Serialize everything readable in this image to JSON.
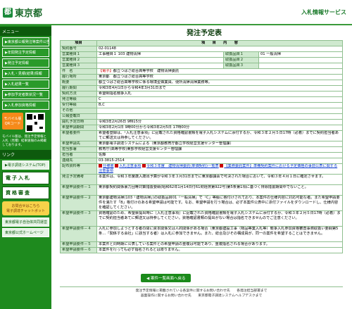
{
  "header": {
    "logo_mark": "都",
    "logo_text": "東京都",
    "service_title": "入札情報サービス"
  },
  "sidebar": {
    "menu_title": "メニュー",
    "items": [
      "▶東京都公報発注等案件公告",
      "▶年間発注予定情報",
      "▶発注予定情報",
      "▶入札・見積(結果)情報",
      "▶入札結果一覧",
      "▶参加予定者数状況一覧",
      "▶入札参加資格情報"
    ],
    "mobile_label": "モバイル版",
    "mobile_sub": "QRコード",
    "note": "モバイル版は、発注予定情報と入札（見積）結果速報のみ掲載しております。",
    "link_title": "リンク",
    "link_items": [
      "▶電子調達システム(TOP)"
    ],
    "big_buttons": [
      "電子入札",
      "資格審査"
    ],
    "help_title": "お問合せはこちら",
    "help_sub": "電子調達チャットボット",
    "bottom_items": [
      "東京都電子自治体共同運営",
      "東京都公式ホームページ"
    ]
  },
  "main": {
    "page_title": "発注予定表",
    "head_item": "項目",
    "head_content": "項　　目　　内　　容",
    "contract_no_label": "契約番号",
    "contract_no": "02-01148",
    "biz_labels": [
      "営業種目１",
      "営業種目２",
      "営業種目３"
    ],
    "biz_values": [
      "工事種目１ 103 建物清掃",
      "",
      ""
    ],
    "sub_labels": [
      "取扱品目１",
      "取扱品目２",
      "取扱品目３"
    ],
    "sub_values": [
      "01 一般清掃",
      "",
      ""
    ],
    "rows": [
      {
        "label": "件　名",
        "tag": "【電子】",
        "value": "都立つばさ総合高等学校　建物清掃委託"
      },
      {
        "label": "履行場所",
        "value": "東京都　都立つばさ総合高等学校"
      },
      {
        "label": "概要",
        "value": "都立つばさ総合高等学校に係る環境型做業員、便所清掃清掃業務等。"
      },
      {
        "label": "履行期間",
        "value": "令和3年4月1日から令和4年3月31日まで"
      },
      {
        "label": "契約方法",
        "value": "希望制指名競争入札"
      },
      {
        "label": "発注等級",
        "value": "C"
      },
      {
        "label": "受付等級",
        "value": "B,C"
      },
      {
        "label": "その他",
        "value": ""
      },
      {
        "label": "公報登載日",
        "value": ""
      },
      {
        "label": "開札予定日時",
        "value": "令和3年2月26日 9時15分"
      },
      {
        "label": "希望申請期間",
        "value": "令和3年2月1日 9時00分から令和3年2月5日 17時00分"
      },
      {
        "label": "希望者要件",
        "value": "希望者登録は、「入札注意事項」に記載された資格確認書類を電子入札システムに添付するか、令和３年２月５日17時（必着）までに契約担当者あてに郵送又は持参してください。"
      },
      {
        "label": "希望申請先",
        "value": "東京都電子調達システムによる（東京都教育庁都立学校経営支援センター管理課）"
      },
      {
        "label": "担当部署",
        "value": "教育庁(高等学校)東部学校経営支援センター管理課"
      },
      {
        "label": "担当者",
        "value": "佐藤"
      },
      {
        "label": "連絡先",
        "value": "03-3815-2514"
      }
    ],
    "attach_label": "配布資料等",
    "attach_files": [
      "仕様書",
      "入札注意事項",
      "令和３年度　建物清掃委託(単価契約)一覧表",
      "【業務委託案件】準備契約案件における予定価格の事前公表に関する注意事項"
    ],
    "note_rows": [
      {
        "label": "発注予定備考",
        "value": "本案件は、令和３年度歳入歳出予算が令和３年３月31日までに東京都議会で可決された場合において、令和３年４月１日に確定させます。"
      },
      {
        "label": "希望申請要件－１",
        "value": "東京都契約関係暴力団等対策措置要綱(昭和62年1月14日付61財経庶第922号)第5条第1項に基づく排除措置期間中でないこと。"
      },
      {
        "label": "希望申請要件－２",
        "value": "東京都建物清掃(103「建物清掃」)の取扱品目01「一般清掃」で「C」等級に格付けされており、本案件の仕様内容に対応可能な者。また希望申請要件を満たす「B」格付けのある希望申請は可能です。なお、希望申請を行う場合は、必ず本案件公表中に添付ファイルをダウンロードし、仕様内容を確認してください。"
      },
      {
        "label": "希望申請要件－３",
        "value": "資格確認のため、希望票提出時に［入札注意事項］に記載された資格確認書類を電子入札システムに添付するか、令和３年２月５日17時（必着）までに契約担当者あてに郵送又は持参してください。資格確認書類の提出がない場合は指名できませんのでご注意ください。"
      },
      {
        "label": "希望申請要件－４",
        "value": "入札に参加しようとする者の間に資本関係又は人的関係がある場合（東京都建設工事（物品等業入札等）競争入札参加資格審査事務取扱い要綱第5条…「関係する会社」に該当する者）は入札に参加できません。また、総合及びその構成員が、同一の案件を希望することはできません。"
      },
      {
        "label": "希望申請要件－５",
        "value": "本案件と同時期に公表している案件との希望申請の重複は可能であり、重複指名される場合があります。"
      },
      {
        "label": "希望申請要件－６",
        "value": "本案件を行っても必ず指名されるとは限りません。"
      }
    ],
    "back_button": "◀ 案件一覧画面へ戻る"
  },
  "footer": {
    "lines": [
      "発注予定情報に掲載されている各案件に関するお問い合わせ先　　各発注担当部署まで",
      "画面操作に関するお問い合わせ先　　東京都電子調達システムヘルプデスクまで"
    ]
  }
}
